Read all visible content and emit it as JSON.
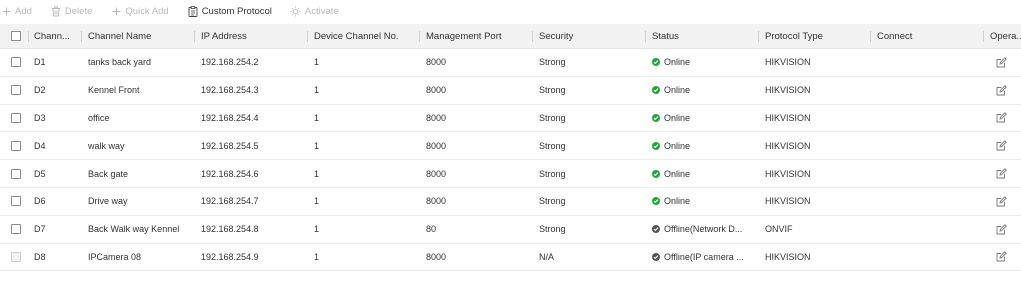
{
  "toolbar": {
    "add_label": "Add",
    "delete_label": "Delete",
    "quick_add_label": "Quick Add",
    "custom_protocol_label": "Custom Protocol",
    "activate_label": "Activate"
  },
  "columns": {
    "channel_no": "Chann...",
    "channel_name": "Channel Name",
    "ip_address": "IP Address",
    "device_channel_no": "Device Channel No.",
    "management_port": "Management Port",
    "security": "Security",
    "status": "Status",
    "protocol_type": "Protocol Type",
    "connect": "Connect",
    "operation": "Opera..."
  },
  "rows": [
    {
      "channel_no": "D1",
      "channel_name": "tanks back yard",
      "ip_address": "192.168.254.2",
      "device_channel_no": "1",
      "management_port": "8000",
      "security": "Strong",
      "status": "Online",
      "status_kind": "online",
      "protocol_type": "HIKVISION",
      "connect": ""
    },
    {
      "channel_no": "D2",
      "channel_name": "Kennel Front",
      "ip_address": "192.168.254.3",
      "device_channel_no": "1",
      "management_port": "8000",
      "security": "Strong",
      "status": "Online",
      "status_kind": "online",
      "protocol_type": "HIKVISION",
      "connect": ""
    },
    {
      "channel_no": "D3",
      "channel_name": "office",
      "ip_address": "192.168.254.4",
      "device_channel_no": "1",
      "management_port": "8000",
      "security": "Strong",
      "status": "Online",
      "status_kind": "online",
      "protocol_type": "HIKVISION",
      "connect": ""
    },
    {
      "channel_no": "D4",
      "channel_name": "walk way",
      "ip_address": "192.168.254.5",
      "device_channel_no": "1",
      "management_port": "8000",
      "security": "Strong",
      "status": "Online",
      "status_kind": "online",
      "protocol_type": "HIKVISION",
      "connect": ""
    },
    {
      "channel_no": "D5",
      "channel_name": "Back gate",
      "ip_address": "192.168.254.6",
      "device_channel_no": "1",
      "management_port": "8000",
      "security": "Strong",
      "status": "Online",
      "status_kind": "online",
      "protocol_type": "HIKVISION",
      "connect": ""
    },
    {
      "channel_no": "D6",
      "channel_name": "Drive way",
      "ip_address": "192.168.254.7",
      "device_channel_no": "1",
      "management_port": "8000",
      "security": "Strong",
      "status": "Online",
      "status_kind": "online",
      "protocol_type": "HIKVISION",
      "connect": ""
    },
    {
      "channel_no": "D7",
      "channel_name": "Back Walk way Kennel",
      "ip_address": "192.168.254.8",
      "device_channel_no": "1",
      "management_port": "80",
      "security": "Strong",
      "status": "Offline(Network D...",
      "status_kind": "offline",
      "protocol_type": "ONVIF",
      "connect": ""
    },
    {
      "channel_no": "D8",
      "channel_name": "IPCamera 08",
      "ip_address": "192.168.254.9",
      "device_channel_no": "1",
      "management_port": "8000",
      "security": "N/A",
      "status": "Offline(IP camera ...",
      "status_kind": "offline",
      "protocol_type": "HIKVISION",
      "connect": "",
      "checkbox_disabled": true
    }
  ],
  "colors": {
    "online": "#21a83b",
    "offline": "#555555",
    "header_bg": "#f2f2f2",
    "disabled_text": "#b8b8b8"
  },
  "icons": {
    "add": "plus-icon",
    "delete": "trash-icon",
    "quick_add": "plus-icon",
    "custom_protocol": "clipboard-icon",
    "activate": "lightbulb-icon",
    "online": "check-circle-icon",
    "offline": "check-circle-icon",
    "operation": "edit-icon"
  }
}
